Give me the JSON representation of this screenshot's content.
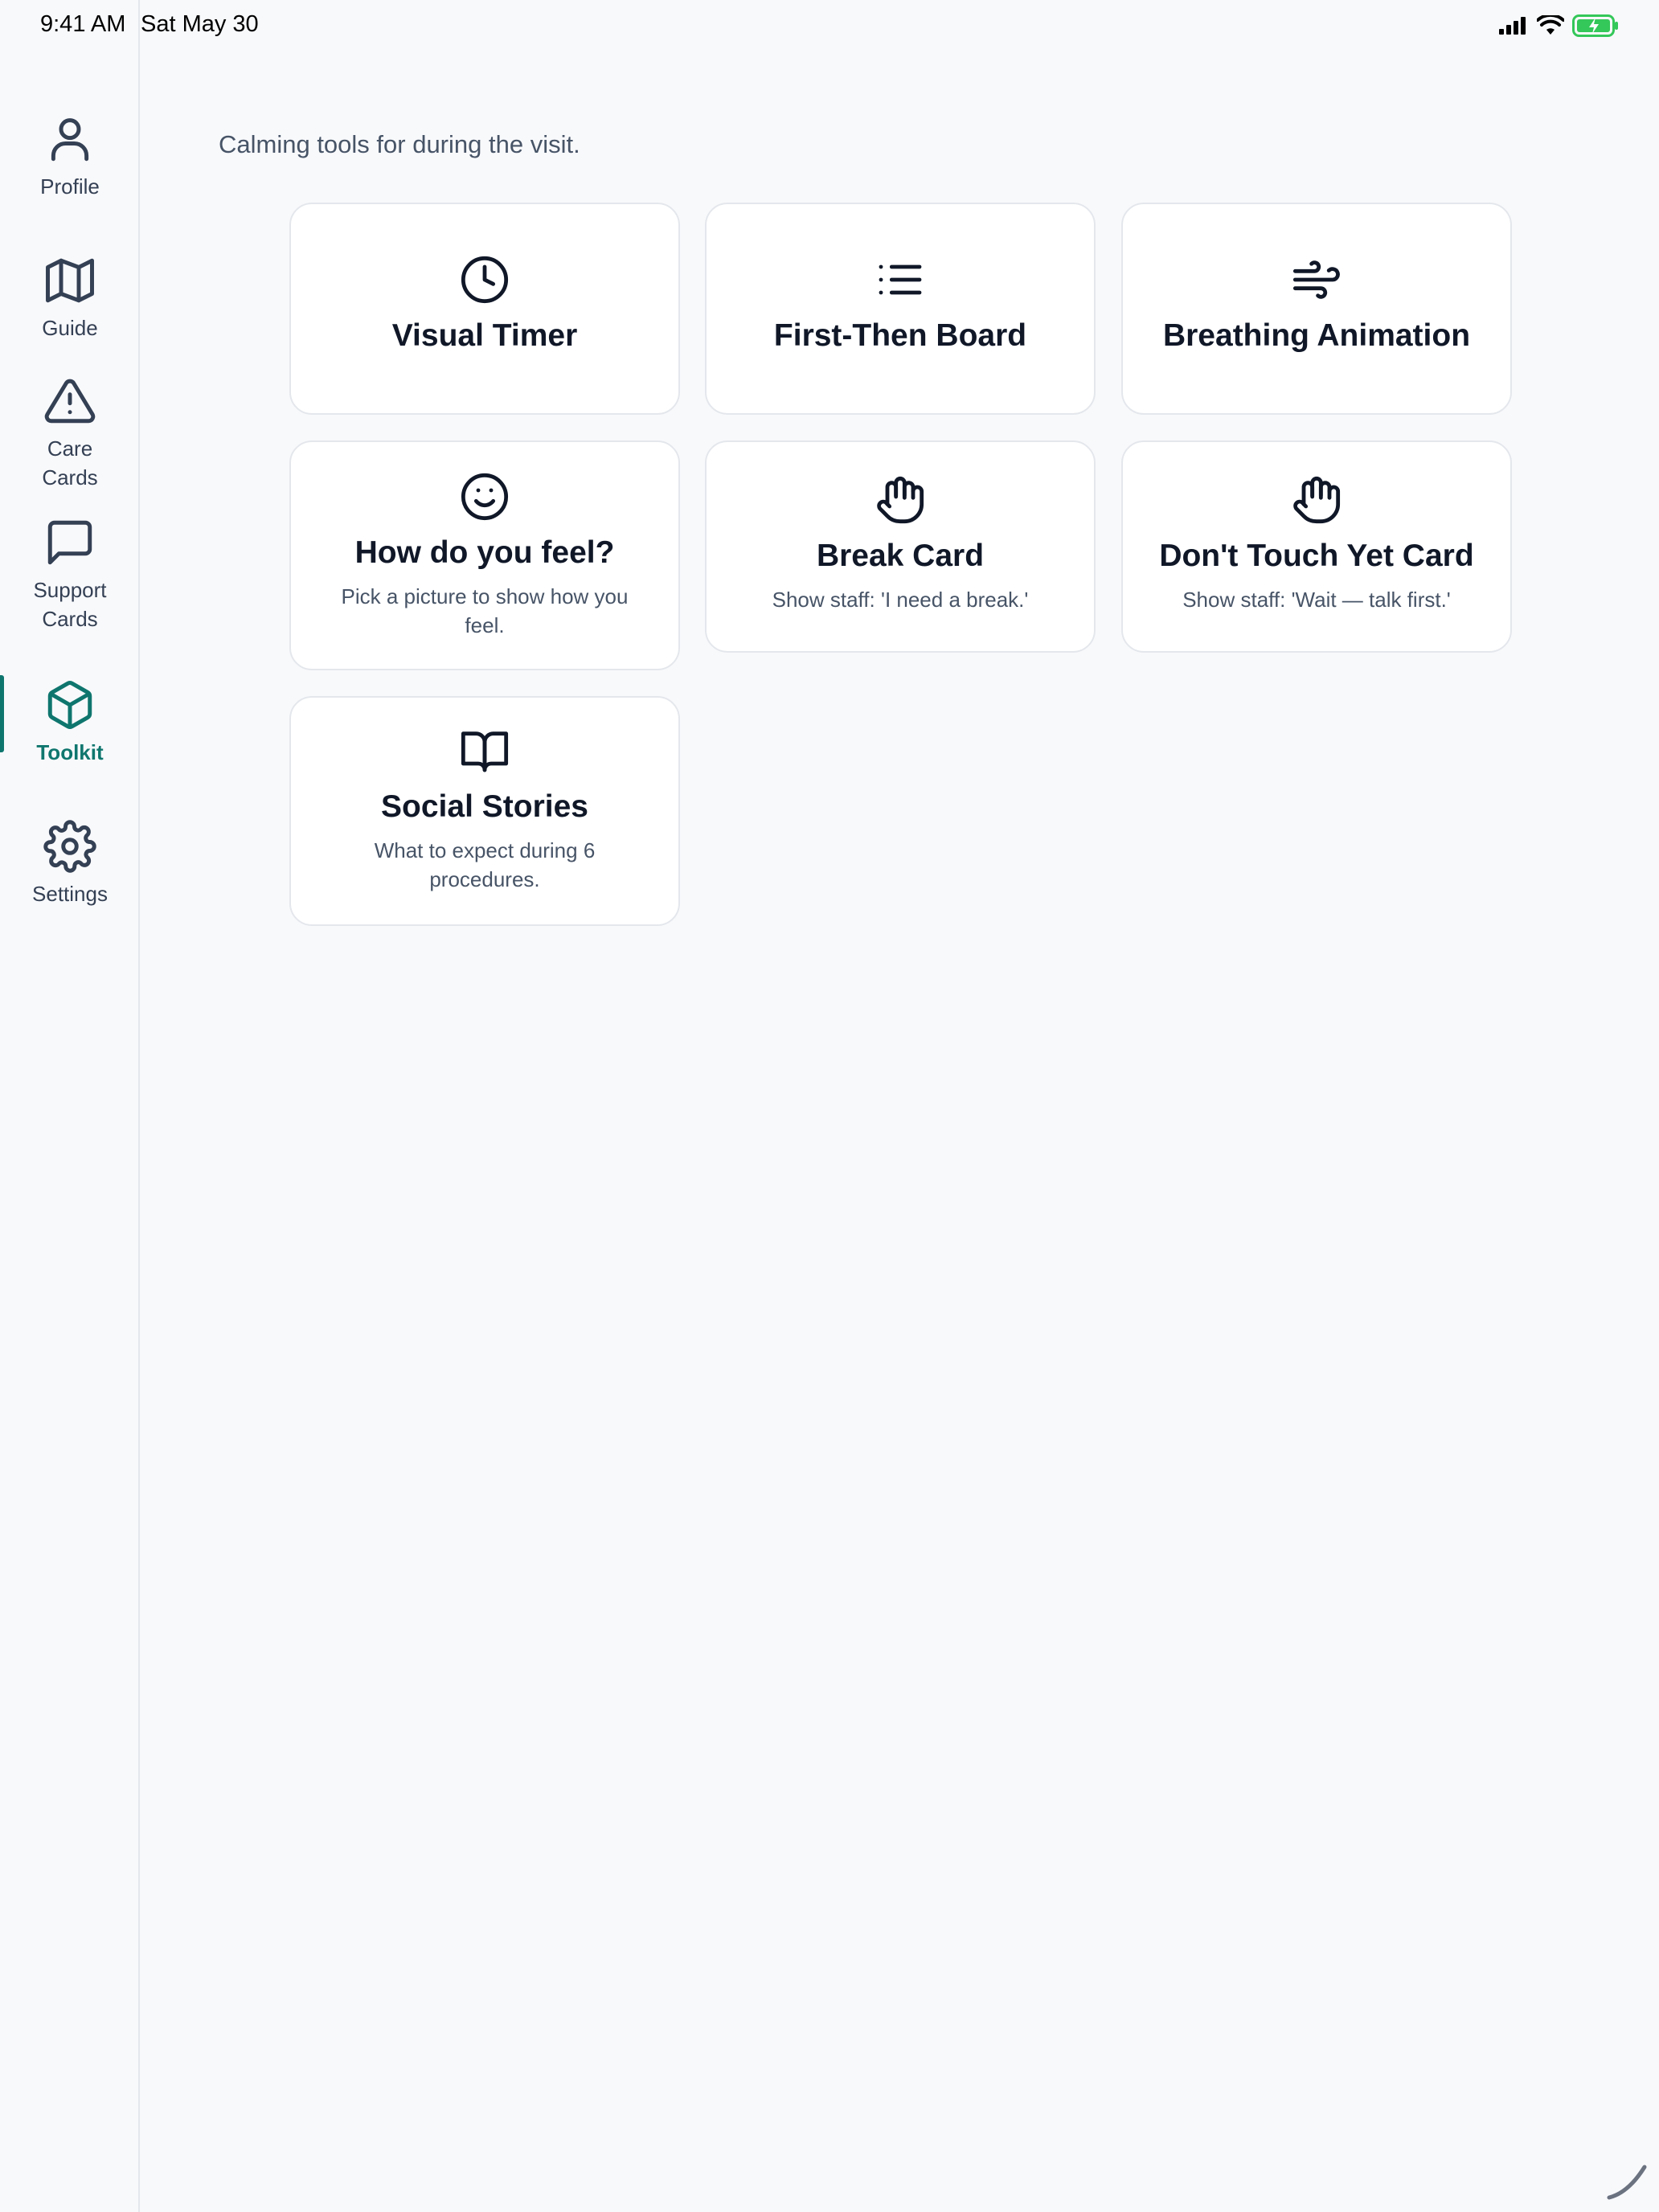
{
  "status_bar": {
    "time": "9:41 AM",
    "date": "Sat May 30"
  },
  "sidebar": {
    "items": [
      {
        "label": "Profile",
        "icon": "user-icon"
      },
      {
        "label": "Guide",
        "icon": "map-icon"
      },
      {
        "label": "Care\nCards",
        "icon": "alert-triangle-icon"
      },
      {
        "label": "Support\nCards",
        "icon": "message-square-icon"
      },
      {
        "label": "Toolkit",
        "icon": "box-icon",
        "active": true
      },
      {
        "label": "Settings",
        "icon": "gear-icon"
      }
    ]
  },
  "main": {
    "subtitle": "Calming tools for during the visit.",
    "cards": [
      {
        "title": "Visual Timer",
        "desc": "",
        "icon": "clock-icon"
      },
      {
        "title": "First-Then Board",
        "desc": "",
        "icon": "list-icon"
      },
      {
        "title": "Breathing Animation",
        "desc": "",
        "icon": "wind-icon"
      },
      {
        "title": "How do you feel?",
        "desc": "Pick a picture to show how you feel.",
        "icon": "smile-icon"
      },
      {
        "title": "Break Card",
        "desc": "Show staff: 'I need a break.'",
        "icon": "hand-icon"
      },
      {
        "title": "Don't Touch Yet Card",
        "desc": "Show staff: 'Wait — talk first.'",
        "icon": "hand-icon"
      },
      {
        "title": "Social Stories",
        "desc": "What to expect during 6 procedures.",
        "icon": "book-open-icon"
      }
    ]
  },
  "colors": {
    "accent": "#0f766e",
    "background": "#f8f9fb",
    "card_border": "#e4e7ec",
    "battery_green": "#34c759"
  }
}
